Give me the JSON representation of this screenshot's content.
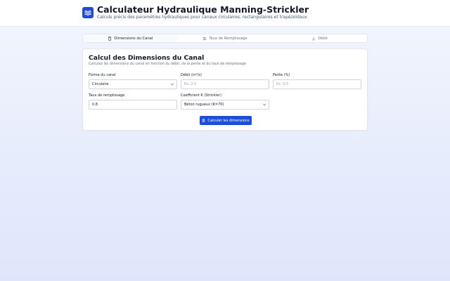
{
  "header": {
    "title": "Calculateur Hydraulique Manning-Strickler",
    "subtitle": "Calculs précis des paramètres hydrauliques pour canaux circulaires, rectangulaires et trapézoïdaux",
    "logo_icon": "waves-icon"
  },
  "tabs": [
    {
      "label": "Dimensions du Canal",
      "icon": "calculator-icon",
      "active": true
    },
    {
      "label": "Taux de Remplissage",
      "icon": "sliders-icon",
      "active": false
    },
    {
      "label": "Débit",
      "icon": "download-icon",
      "active": false
    }
  ],
  "card": {
    "title": "Calcul des Dimensions du Canal",
    "description": "Calculez les dimensions du canal en fonction du débit, de la pente et du taux de remplissage"
  },
  "form": {
    "shape": {
      "label": "Forme du canal",
      "value": "Circulaire"
    },
    "flow": {
      "label": "Débit (m³/s)",
      "placeholder": "Ex: 2.5"
    },
    "slope": {
      "label": "Pente (%)",
      "placeholder": "Ex: 0.5"
    },
    "fill": {
      "label": "Taux de remplissage",
      "value": "0.8"
    },
    "strickler": {
      "label": "Coefficient K (Strickler)",
      "value": "Béton rugueux (K=70)"
    }
  },
  "button": {
    "label": "Calculer les dimensions"
  },
  "colors": {
    "accent": "#1d4ed8",
    "logo": "#2149dc"
  }
}
